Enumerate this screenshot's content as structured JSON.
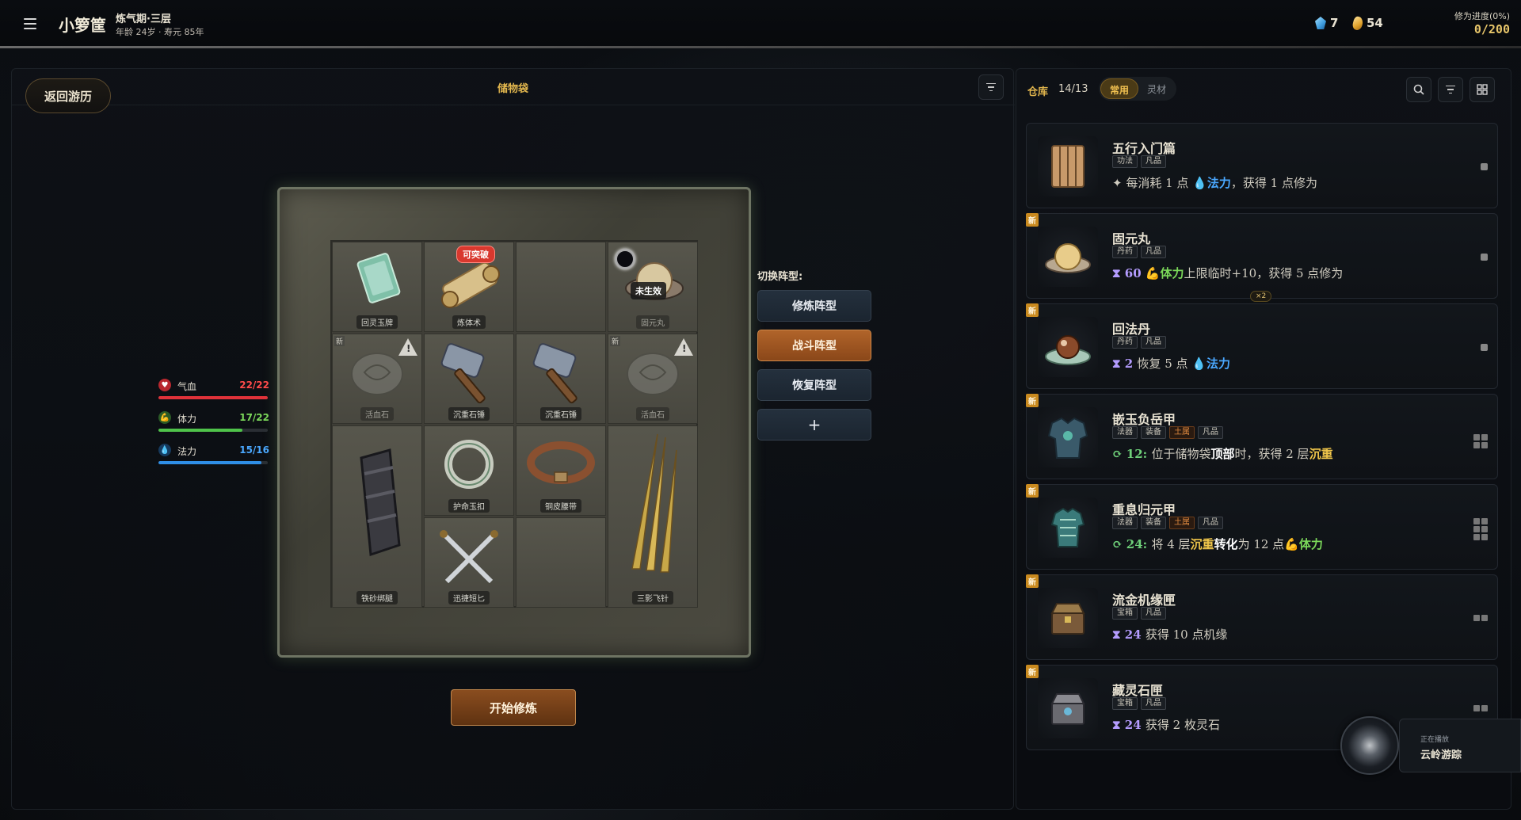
{
  "header": {
    "name": "小箩筐",
    "realm": "炼气期·三层",
    "age": "年龄 24岁 · 寿元 85年",
    "spirit_stones": "7",
    "gold": "54",
    "cultivation_label": "修为进度(0%)",
    "cultivation_value": "0/200"
  },
  "left": {
    "back_label": "返回游历",
    "bag_title": "储物袋",
    "stats": [
      {
        "name": "气血",
        "value": "22/22",
        "fill": 1.0,
        "color": "#e0323a"
      },
      {
        "name": "体力",
        "value": "17/22",
        "fill": 0.77,
        "color": "#4fc34a"
      },
      {
        "name": "法力",
        "value": "15/16",
        "fill": 0.94,
        "color": "#2f8ee6"
      }
    ],
    "grid": {
      "badge_breakthrough": "可突破",
      "badge_inactive": "未生效",
      "new_tag": "新",
      "labels": {
        "jade_card": "回灵玉牌",
        "scroll": "炼体术",
        "pill": "固元丸",
        "stone1": "活血石",
        "hammer1": "沉重石锤",
        "hammer2": "沉重石锤",
        "stone2": "活血石",
        "bracer": "铁砂绑腿",
        "ring": "护命玉扣",
        "belt": "铜皮腰带",
        "needles": "三影飞针",
        "daggers": "迅捷短匕"
      }
    },
    "formation": {
      "label": "切换阵型:",
      "buttons": [
        "修炼阵型",
        "战斗阵型",
        "恢复阵型",
        "+"
      ],
      "active_index": 1
    },
    "start_label": "开始修炼"
  },
  "right": {
    "warehouse_label": "仓库",
    "warehouse_count": "14/13",
    "tabs": [
      "常用",
      "灵材"
    ],
    "active_tab": 0,
    "x2_badge": "×2",
    "items": [
      {
        "name": "五行入门篇",
        "tags": [
          "功法",
          "凡品"
        ],
        "new": false,
        "desc": [
          [
            "",
            "✦ 每消耗 1 点 "
          ],
          [
            "hl-blue",
            "💧法力"
          ],
          [
            "",
            "，获得 1 点修为"
          ]
        ]
      },
      {
        "name": "固元丸",
        "tags": [
          "丹药",
          "凡品"
        ],
        "new": true,
        "desc": [
          [
            "num-purple",
            "⧗ 60 "
          ],
          [
            "hl-green",
            "💪体力"
          ],
          [
            "",
            "上限临时+10，获得 5 点修为"
          ]
        ]
      },
      {
        "name": "回法丹",
        "tags": [
          "丹药",
          "凡品"
        ],
        "new": true,
        "desc": [
          [
            "num-purple",
            "⧗ 2 "
          ],
          [
            "",
            "恢复 5 点 "
          ],
          [
            "hl-blue",
            "💧法力"
          ]
        ]
      },
      {
        "name": "嵌玉负岳甲",
        "tags": [
          "法器",
          "装备",
          "土属",
          "凡品"
        ],
        "new": true,
        "desc": [
          [
            "num-green",
            "⟳ 12: "
          ],
          [
            "",
            " 位于储物袋"
          ],
          [
            "hl-white",
            "顶部"
          ],
          [
            "",
            "时，获得 2 层"
          ],
          [
            "hl-gold",
            "沉重"
          ]
        ]
      },
      {
        "name": "重息归元甲",
        "tags": [
          "法器",
          "装备",
          "土属",
          "凡品"
        ],
        "new": true,
        "desc": [
          [
            "num-green",
            "⟳ 24: "
          ],
          [
            "",
            " 将 4 层"
          ],
          [
            "hl-gold",
            "沉重"
          ],
          [
            "hl-white",
            "转化"
          ],
          [
            "",
            "为 12 点"
          ],
          [
            "hl-green",
            "💪体力"
          ]
        ]
      },
      {
        "name": "流金机缘匣",
        "tags": [
          "宝箱",
          "凡品"
        ],
        "new": true,
        "desc": [
          [
            "num-purple",
            "⧗ 24 "
          ],
          [
            "",
            "获得 10 点机缘"
          ]
        ]
      },
      {
        "name": "藏灵石匣",
        "tags": [
          "宝箱",
          "凡品"
        ],
        "new": true,
        "desc": [
          [
            "num-purple",
            "⧗ 24 "
          ],
          [
            "",
            "获得 2 枚灵石"
          ]
        ]
      }
    ],
    "new_badge": "新"
  },
  "music": {
    "status": "正在播放",
    "title": "云岭游踪"
  }
}
